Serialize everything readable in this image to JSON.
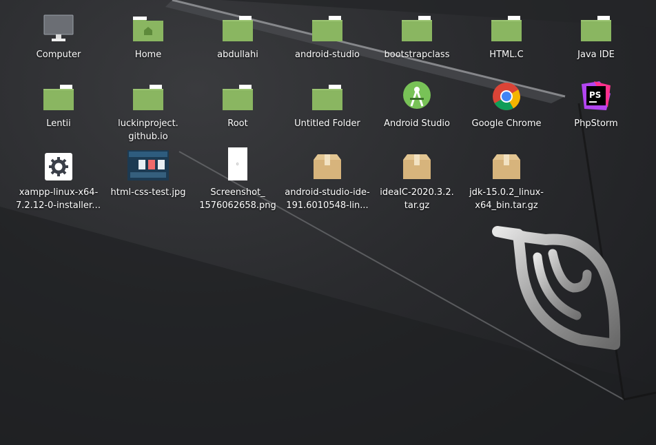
{
  "desktop": {
    "icons": [
      {
        "label": "Computer",
        "lines": [
          "Computer"
        ],
        "icon": "computer-icon"
      },
      {
        "label": "Home",
        "lines": [
          "Home"
        ],
        "icon": "home-folder-icon"
      },
      {
        "label": "abdullahi",
        "lines": [
          "abdullahi"
        ],
        "icon": "folder-icon"
      },
      {
        "label": "android-studio",
        "lines": [
          "android-studio"
        ],
        "icon": "folder-icon"
      },
      {
        "label": "bootstrapclass",
        "lines": [
          "bootstrapclass"
        ],
        "icon": "folder-icon"
      },
      {
        "label": "HTML.C",
        "lines": [
          "HTML.C"
        ],
        "icon": "folder-icon"
      },
      {
        "label": "Java IDE",
        "lines": [
          "Java IDE"
        ],
        "icon": "folder-icon"
      },
      {
        "label": "Lentii",
        "lines": [
          "Lentii"
        ],
        "icon": "folder-icon"
      },
      {
        "label": "luckinproject.github.io",
        "lines": [
          "luckinproject.",
          "github.io"
        ],
        "icon": "folder-icon"
      },
      {
        "label": "Root",
        "lines": [
          "Root"
        ],
        "icon": "folder-icon"
      },
      {
        "label": "Untitled Folder",
        "lines": [
          "Untitled Folder"
        ],
        "icon": "folder-icon"
      },
      {
        "label": "Android Studio",
        "lines": [
          "Android Studio"
        ],
        "icon": "android-studio-icon"
      },
      {
        "label": "Google Chrome",
        "lines": [
          "Google Chrome"
        ],
        "icon": "chrome-icon"
      },
      {
        "label": "PhpStorm",
        "lines": [
          "PhpStorm"
        ],
        "icon": "phpstorm-icon"
      },
      {
        "label": "xampp-linux-x64-7.2.12-0-installer....",
        "lines": [
          "xampp-linux-x64-",
          "7.2.12-0-installer...."
        ],
        "icon": "installer-gear-icon"
      },
      {
        "label": "html-css-test.jpg",
        "lines": [
          "html-css-test.jpg"
        ],
        "icon": "image-thumbnail-icon"
      },
      {
        "label": "Screenshot_1576062658.png",
        "lines": [
          "Screenshot_",
          "1576062658.png"
        ],
        "icon": "screenshot-thumbnail-icon"
      },
      {
        "label": "android-studio-ide-191.6010548-lin...",
        "lines": [
          "android-studio-ide-",
          "191.6010548-lin..."
        ],
        "icon": "archive-icon"
      },
      {
        "label": "ideaIC-2020.3.2.tar.gz",
        "lines": [
          "ideaIC-2020.3.2.",
          "tar.gz"
        ],
        "icon": "archive-icon"
      },
      {
        "label": "jdk-15.0.2_linux-x64_bin.tar.gz",
        "lines": [
          "jdk-15.0.2_linux-",
          "x64_bin.tar.gz"
        ],
        "icon": "archive-icon"
      }
    ],
    "phpstorm_badge": "PS",
    "colors": {
      "folder": "#8ab661",
      "folder_tab": "#ffffff",
      "archive": "#d7b47c",
      "label_text": "#ffffff"
    }
  }
}
